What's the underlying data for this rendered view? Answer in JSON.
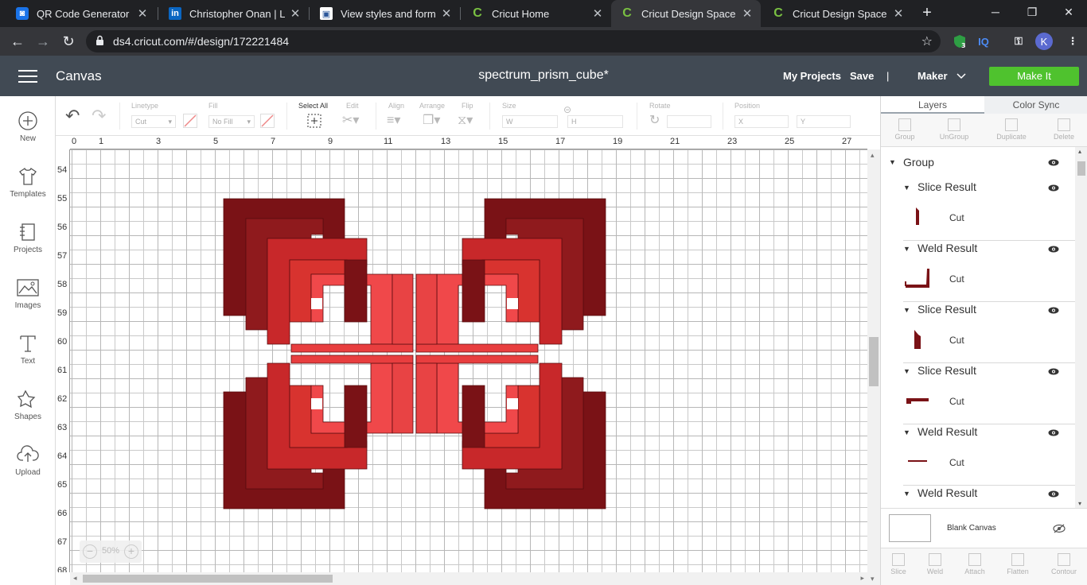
{
  "browser": {
    "tabs": [
      {
        "title": "QR Code Generator - N",
        "favicon": "qr-icon",
        "active": false
      },
      {
        "title": "Christopher Onan | Link",
        "favicon": "linkedin-icon",
        "active": false
      },
      {
        "title": "View styles and formatt",
        "favicon": "doc-icon",
        "active": false
      },
      {
        "title": "Cricut Home",
        "favicon": "cricut-icon",
        "active": false
      },
      {
        "title": "Cricut Design Space",
        "favicon": "cricut-icon",
        "active": true
      },
      {
        "title": "Cricut Design Space",
        "favicon": "cricut-icon",
        "active": false
      }
    ],
    "url": "ds4.cricut.com/#/design/172221484",
    "ext_badge": "3",
    "ext_iq": "IQ",
    "profile": "K"
  },
  "header": {
    "app_title": "Canvas",
    "doc_title": "spectrum_prism_cube*",
    "my_projects": "My Projects",
    "save": "Save",
    "divider": "|",
    "machine": "Maker",
    "make_it": "Make It"
  },
  "sidebar": {
    "items": [
      {
        "label": "New",
        "icon": "plus-circle-icon"
      },
      {
        "label": "Templates",
        "icon": "shirt-icon"
      },
      {
        "label": "Projects",
        "icon": "projects-icon"
      },
      {
        "label": "Images",
        "icon": "image-icon"
      },
      {
        "label": "Text",
        "icon": "text-icon"
      },
      {
        "label": "Shapes",
        "icon": "shapes-icon"
      },
      {
        "label": "Upload",
        "icon": "upload-icon"
      }
    ]
  },
  "edit_bar": {
    "linetype_label": "Linetype",
    "linetype_value": "Cut",
    "fill_label": "Fill",
    "fill_value": "No Fill",
    "select_all": "Select All",
    "edit": "Edit",
    "align": "Align",
    "arrange": "Arrange",
    "flip": "Flip",
    "size": "Size",
    "size_w": "W",
    "size_h": "H",
    "rotate": "Rotate",
    "position": "Position",
    "pos_x": "X",
    "pos_y": "Y"
  },
  "ruler": {
    "top": [
      "0",
      "1",
      "3",
      "5",
      "7",
      "9",
      "11",
      "13",
      "15",
      "17",
      "19",
      "21",
      "23",
      "25",
      "27"
    ],
    "left": [
      "54",
      "55",
      "56",
      "57",
      "58",
      "59",
      "60",
      "61",
      "62",
      "63",
      "64",
      "65",
      "66",
      "67",
      "68"
    ]
  },
  "zoom": {
    "value": "50%",
    "minus": "−",
    "plus": "+"
  },
  "panel": {
    "tab_layers": "Layers",
    "tab_color_sync": "Color Sync",
    "tools": [
      "Group",
      "UnGroup",
      "Duplicate",
      "Delete"
    ],
    "group_label": "Group",
    "layers": [
      {
        "name": "Slice Result",
        "cut": "Cut",
        "thumb": "bar-thumb"
      },
      {
        "name": "Weld Result",
        "cut": "Cut",
        "thumb": "corner-thumb"
      },
      {
        "name": "Slice Result",
        "cut": "Cut",
        "thumb": "chevron-thumb"
      },
      {
        "name": "Slice Result",
        "cut": "Cut",
        "thumb": "flat-thumb"
      },
      {
        "name": "Weld Result",
        "cut": "Cut",
        "thumb": "line-thumb"
      },
      {
        "name": "Weld Result",
        "cut": "",
        "thumb": ""
      }
    ],
    "blank_canvas": "Blank Canvas",
    "bottom_tools": [
      "Slice",
      "Weld",
      "Attach",
      "Flatten",
      "Contour"
    ]
  },
  "colors": {
    "header_bg": "#414a54",
    "make_it_green": "#4fc22e",
    "dark_red": "#7a1216",
    "mid_red": "#c8282a",
    "light_red": "#f0484a"
  }
}
